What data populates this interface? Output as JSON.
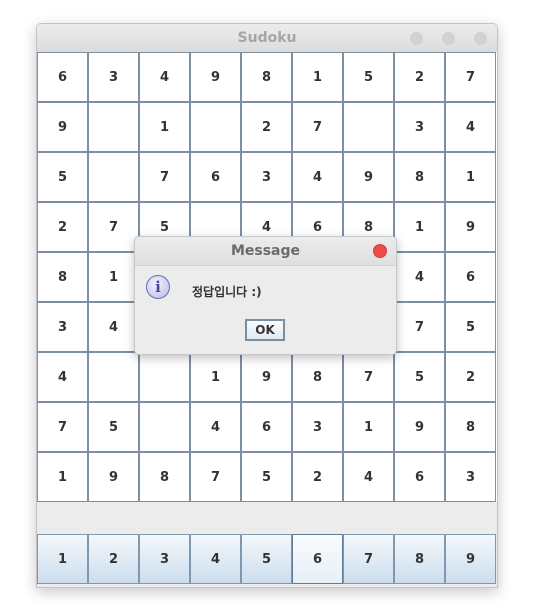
{
  "window": {
    "title": "Sudoku"
  },
  "board": {
    "rows": [
      [
        "6",
        "3",
        "4",
        "9",
        "8",
        "1",
        "5",
        "2",
        "7"
      ],
      [
        "9",
        "",
        "1",
        "",
        "2",
        "7",
        "",
        "3",
        "4"
      ],
      [
        "5",
        "",
        "7",
        "6",
        "3",
        "4",
        "9",
        "8",
        "1"
      ],
      [
        "2",
        "7",
        "5",
        "",
        "4",
        "6",
        "8",
        "1",
        "9"
      ],
      [
        "8",
        "1",
        "",
        "",
        "",
        "",
        "",
        "4",
        "6"
      ],
      [
        "3",
        "4",
        "",
        "",
        "",
        "",
        "",
        "7",
        "5"
      ],
      [
        "4",
        "",
        "",
        "1",
        "9",
        "8",
        "7",
        "5",
        "2"
      ],
      [
        "7",
        "5",
        "",
        "4",
        "6",
        "3",
        "1",
        "9",
        "8"
      ],
      [
        "1",
        "9",
        "8",
        "7",
        "5",
        "2",
        "4",
        "6",
        "3"
      ]
    ]
  },
  "number_buttons": [
    "1",
    "2",
    "3",
    "4",
    "5",
    "6",
    "7",
    "8",
    "9"
  ],
  "selected_number": "6",
  "dialog": {
    "title": "Message",
    "message": "정답입니다 :)",
    "ok_label": "OK",
    "icon": "info-icon"
  },
  "colors": {
    "cell_border": "#7c8fa3",
    "button_gradient_bottom": "#ccdeee",
    "close_button": "#ee4b4b"
  }
}
